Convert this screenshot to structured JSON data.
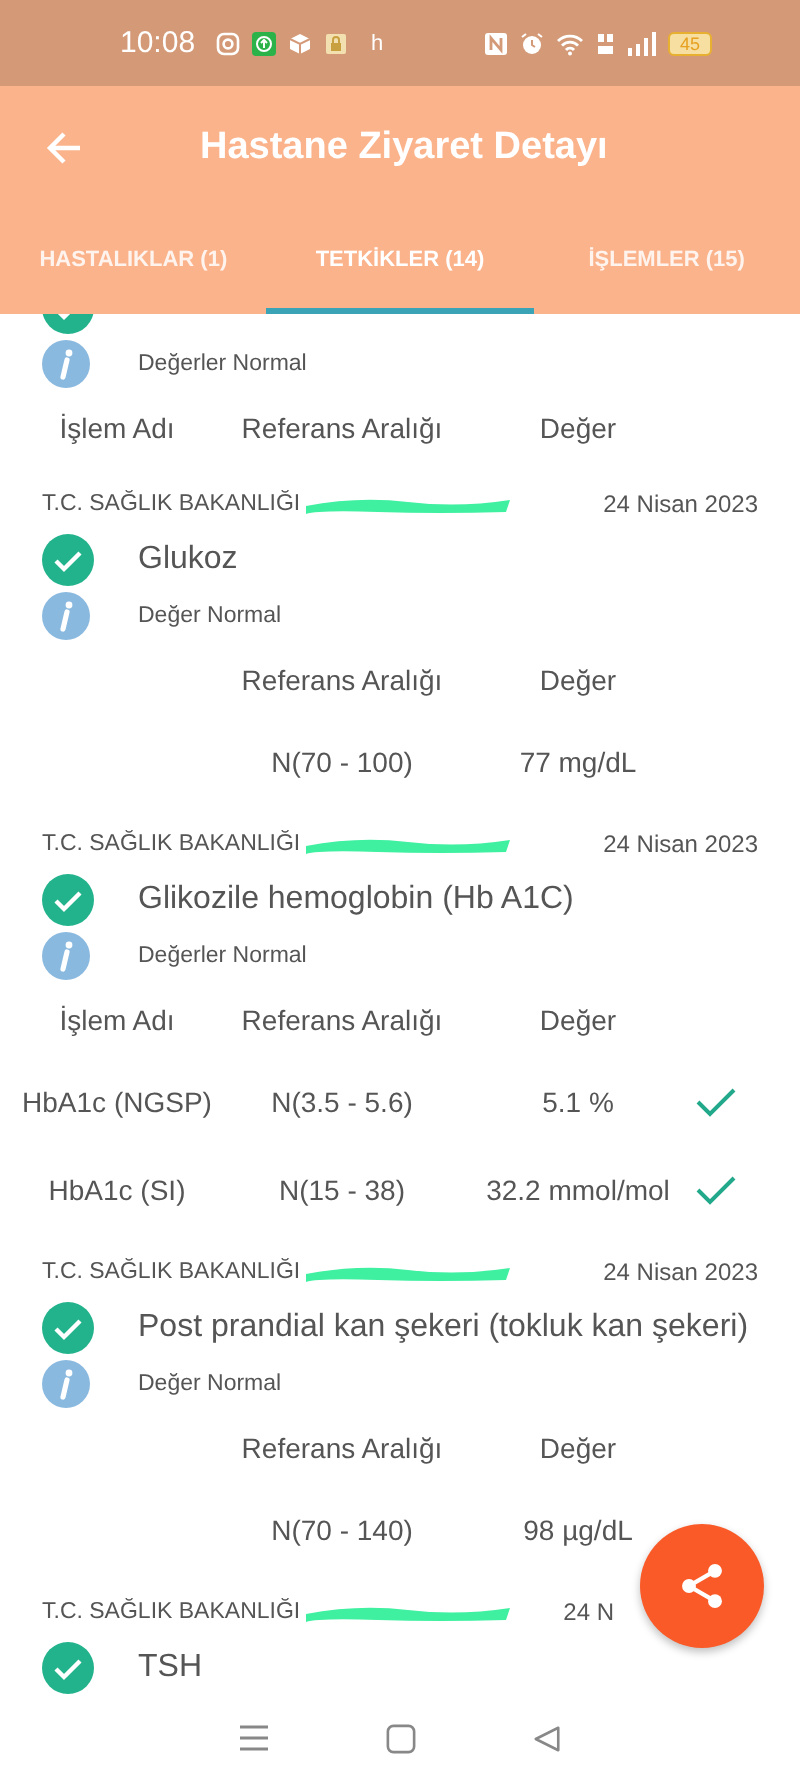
{
  "status_bar": {
    "time": "10:08",
    "app_letter": "h",
    "battery": "45"
  },
  "app_bar": {
    "title": "Hastane Ziyaret Detayı"
  },
  "tabs": [
    {
      "label": "HASTALIKLAR (1)",
      "selected": false
    },
    {
      "label": "TETKİKLER (14)",
      "selected": true
    },
    {
      "label": "İŞLEMLER (15)",
      "selected": false
    }
  ],
  "records": [
    {
      "checked": true,
      "note": "Değerler Normal",
      "columns": {
        "name": "İşlem Adı",
        "reference": "Referans Aralığı",
        "value": "Değer"
      }
    },
    {
      "source": "T.C. SAĞLIK BAKANLIĞI",
      "redacted": true,
      "date": "24 Nisan 2023",
      "checked": true,
      "title": "Glukoz",
      "note": "Değer Normal",
      "columns": {
        "reference": "Referans Aralığı",
        "value": "Değer"
      },
      "rows": [
        {
          "reference": "N(70 - 100)",
          "value": "77 mg/dL",
          "ok": false
        }
      ]
    },
    {
      "source": "T.C. SAĞLIK BAKANLIĞI",
      "redacted": true,
      "date": "24 Nisan 2023",
      "checked": true,
      "title": "Glikozile hemoglobin (Hb A1C)",
      "note": "Değerler Normal",
      "columns": {
        "name": "İşlem Adı",
        "reference": "Referans Aralığı",
        "value": "Değer"
      },
      "rows": [
        {
          "name": "HbA1c (NGSP)",
          "reference": "N(3.5 - 5.6)",
          "value": "5.1 %",
          "ok": true
        },
        {
          "name": "HbA1c (SI)",
          "reference": "N(15 - 38)",
          "value": "32.2 mmol/mol",
          "ok": true
        }
      ]
    },
    {
      "source": "T.C. SAĞLIK BAKANLIĞI",
      "redacted": true,
      "date": "24 Nisan 2023",
      "checked": true,
      "title": "Post prandial kan şekeri (tokluk kan şekeri)",
      "note": "Değer Normal",
      "columns": {
        "reference": "Referans Aralığı",
        "value": "Değer"
      },
      "rows": [
        {
          "reference": "N(70 - 140)",
          "value": "98 µg/dL",
          "ok": false
        }
      ]
    },
    {
      "source": "T.C. SAĞLIK BAKANLIĞI",
      "redacted": true,
      "date": "24 N",
      "checked": true,
      "title": "TSH"
    }
  ]
}
